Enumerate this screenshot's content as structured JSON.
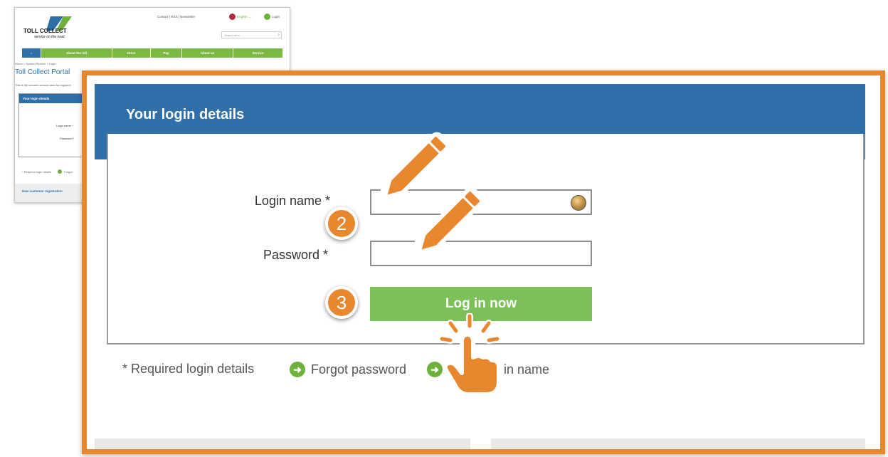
{
  "background_page": {
    "brand": "TOLL COLLECT",
    "slogan": "service on the road",
    "top_links": "Contact  |  RSS  |  Newsletter",
    "language": "English",
    "login_link": "Login",
    "search_placeholder": "Search term",
    "nav": [
      "About the toll",
      "Drive",
      "Pay",
      "About us",
      "Service"
    ],
    "breadcrumb": "Home  >  System-Service  >  Login",
    "title": "Toll Collect Portal",
    "intro": "This is the secured service area for registere",
    "panel_title": "Your login details",
    "login_name_label": "Login name *",
    "password_label": "Password *",
    "footer_required": "* Required login details",
    "footer_forgot": "Forgot",
    "new_customer": "New customer registration"
  },
  "zoom": {
    "header_title": "Your login details",
    "login_name_label": "Login name *",
    "password_label": "Password *",
    "login_name_value": "",
    "password_value": "",
    "login_button": "Log in now",
    "required_note": "* Required login details",
    "forgot_password": "Forgot password",
    "forgot_login_partial": "in name"
  },
  "annotations": {
    "step_2": "2",
    "step_3": "3"
  },
  "colors": {
    "accent_orange": "#e8872d",
    "header_blue": "#2f70ab",
    "button_green": "#7cc05a",
    "link_green": "#6fb13d"
  }
}
